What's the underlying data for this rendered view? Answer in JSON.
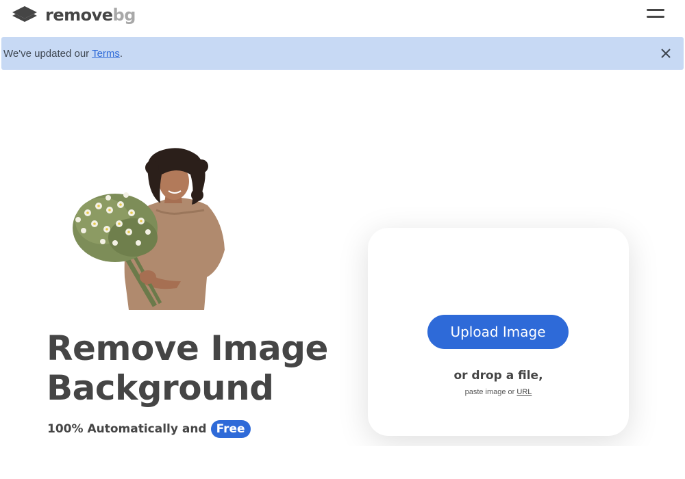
{
  "header": {
    "logo": {
      "name_main": "remove",
      "name_accent": "bg",
      "icon": "layers-logo-icon"
    },
    "menu_icon": "hamburger-menu-icon"
  },
  "banner": {
    "text_prefix": "We've updated our ",
    "link_label": "Terms",
    "text_suffix": ".",
    "close_icon": "close-icon",
    "background": "#c7d9f4"
  },
  "hero": {
    "title_line1": "Remove Image",
    "title_line2": "Background",
    "subtitle": "100% Automatically and",
    "badge": "Free"
  },
  "upload": {
    "button_label": "Upload Image",
    "drop_text": "or drop a file,",
    "paste_prefix": "paste image or ",
    "url_label": "URL"
  },
  "colors": {
    "accent": "#2e6ad8",
    "text": "#454545",
    "logo_accent": "#a8a8a8"
  }
}
